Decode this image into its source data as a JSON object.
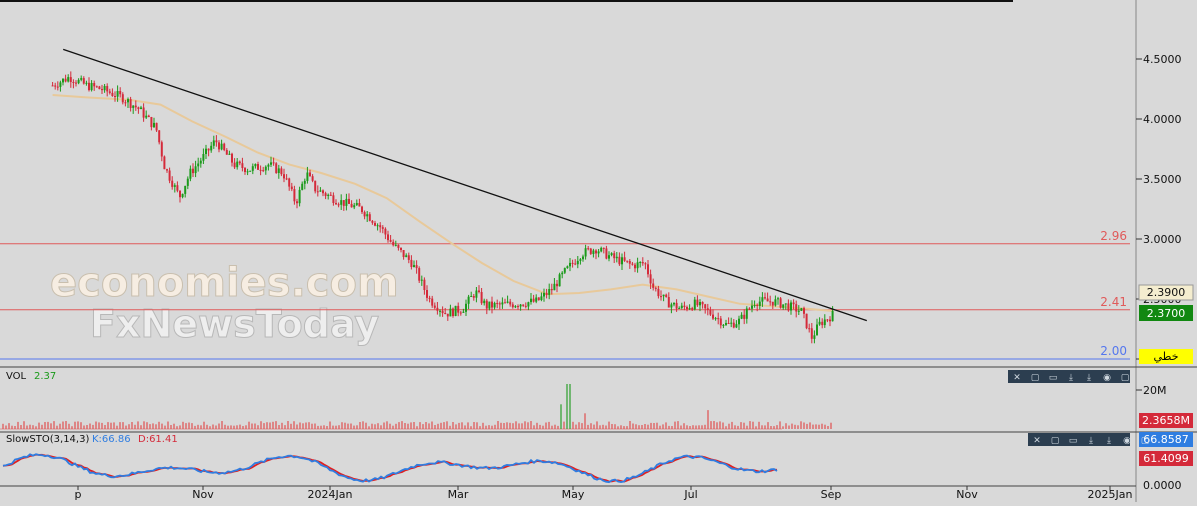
{
  "colors": {
    "background": "#d9d9d9",
    "bull": "#1a9a1a",
    "bear": "#d42a3a",
    "ma": "#e8c99a",
    "trendline": "#111111",
    "level_red": "#e05a5a",
    "level_blue": "#5577ee",
    "stoch_k": "#2f7de1",
    "stoch_d": "#e02020",
    "volume": "#e05050"
  },
  "watermark": {
    "line1": "economies.com",
    "line2": "FxNewsToday"
  },
  "price_panel": {
    "y_ticks": [
      "4.5000",
      "4.0000",
      "3.5000",
      "3.0000",
      "2.5000",
      "2.0000"
    ],
    "levels": [
      {
        "label": "2.96",
        "value": 2.96,
        "color": "#e05a5a"
      },
      {
        "label": "2.41",
        "value": 2.41,
        "color": "#e05a5a"
      },
      {
        "label": "2.00",
        "value": 2.0,
        "color": "#5577ee"
      }
    ],
    "tag_prev": "2.3900",
    "tag_last": "2.3700",
    "tag_arabic": "خطي"
  },
  "volume_panel": {
    "name": "VOL",
    "value": "2.37",
    "y_tick": "20M",
    "tag": "2.3658M"
  },
  "stoch_panel": {
    "name": "SlowSTO(3,14,3)",
    "k_text": "K:66.86",
    "d_text": "D:61.41",
    "y_tick": "0.0000",
    "tag_k": "66.8587",
    "tag_d": "61.4099"
  },
  "panel_buttons": [
    "✕",
    "▢",
    "▭",
    "⤓",
    "⤓",
    "◉",
    "▢"
  ],
  "x_ticks": [
    "Sep",
    "Nov",
    "2024Jan",
    "Mar",
    "May",
    "Jul",
    "Sep",
    "Nov",
    "2025Jan"
  ],
  "chart_data": {
    "type": "candlestick",
    "x_range": [
      "2023-09-01",
      "2025-01-01"
    ],
    "ylim": [
      1.95,
      4.7
    ],
    "grid": false,
    "price_path": [
      [
        "2023-08-20",
        4.28
      ],
      [
        "2023-08-28",
        4.35
      ],
      [
        "2023-09-05",
        4.28
      ],
      [
        "2023-09-12",
        4.25
      ],
      [
        "2023-09-22",
        4.18
      ],
      [
        "2023-09-30",
        4.08
      ],
      [
        "2023-10-08",
        3.92
      ],
      [
        "2023-10-12",
        3.6
      ],
      [
        "2023-10-19",
        3.35
      ],
      [
        "2023-10-24",
        3.55
      ],
      [
        "2023-10-31",
        3.7
      ],
      [
        "2023-11-05",
        3.82
      ],
      [
        "2023-11-14",
        3.62
      ],
      [
        "2023-11-21",
        3.58
      ],
      [
        "2023-11-30",
        3.62
      ],
      [
        "2023-12-07",
        3.55
      ],
      [
        "2023-12-13",
        3.3
      ],
      [
        "2023-12-18",
        3.55
      ],
      [
        "2023-12-22",
        3.42
      ],
      [
        "2024-01-02",
        3.32
      ],
      [
        "2024-01-13",
        3.25
      ],
      [
        "2024-01-22",
        3.1
      ],
      [
        "2024-01-28",
        2.95
      ],
      [
        "2024-02-06",
        2.8
      ],
      [
        "2024-02-14",
        2.5
      ],
      [
        "2024-02-22",
        2.38
      ],
      [
        "2024-03-01",
        2.42
      ],
      [
        "2024-03-07",
        2.56
      ],
      [
        "2024-03-12",
        2.44
      ],
      [
        "2024-03-25",
        2.46
      ],
      [
        "2024-04-05",
        2.48
      ],
      [
        "2024-04-12",
        2.58
      ],
      [
        "2024-04-18",
        2.72
      ],
      [
        "2024-04-26",
        2.88
      ],
      [
        "2024-05-03",
        2.92
      ],
      [
        "2024-05-10",
        2.85
      ],
      [
        "2024-05-20",
        2.78
      ],
      [
        "2024-05-26",
        2.8
      ],
      [
        "2024-05-30",
        2.6
      ],
      [
        "2024-06-05",
        2.48
      ],
      [
        "2024-06-12",
        2.42
      ],
      [
        "2024-06-19",
        2.46
      ],
      [
        "2024-06-28",
        2.36
      ],
      [
        "2024-07-04",
        2.28
      ],
      [
        "2024-07-10",
        2.32
      ],
      [
        "2024-07-17",
        2.48
      ],
      [
        "2024-07-26",
        2.48
      ],
      [
        "2024-08-02",
        2.44
      ],
      [
        "2024-08-08",
        2.4
      ],
      [
        "2024-08-13",
        2.18
      ],
      [
        "2024-08-17",
        2.3
      ],
      [
        "2024-08-23",
        2.37
      ]
    ],
    "ma_path": [
      [
        "2023-08-20",
        4.2
      ],
      [
        "2023-09-05",
        4.18
      ],
      [
        "2023-09-25",
        4.16
      ],
      [
        "2023-10-10",
        4.12
      ],
      [
        "2023-10-25",
        3.98
      ],
      [
        "2023-11-10",
        3.85
      ],
      [
        "2023-11-25",
        3.72
      ],
      [
        "2023-12-10",
        3.62
      ],
      [
        "2023-12-25",
        3.55
      ],
      [
        "2024-01-10",
        3.46
      ],
      [
        "2024-01-25",
        3.34
      ],
      [
        "2024-02-10",
        3.14
      ],
      [
        "2024-02-25",
        2.96
      ],
      [
        "2024-03-10",
        2.8
      ],
      [
        "2024-03-25",
        2.65
      ],
      [
        "2024-04-10",
        2.54
      ],
      [
        "2024-04-25",
        2.55
      ],
      [
        "2024-05-10",
        2.58
      ],
      [
        "2024-05-25",
        2.62
      ],
      [
        "2024-06-10",
        2.58
      ],
      [
        "2024-06-25",
        2.52
      ],
      [
        "2024-07-10",
        2.46
      ],
      [
        "2024-07-25",
        2.44
      ],
      [
        "2024-08-10",
        2.42
      ],
      [
        "2024-08-23",
        2.4
      ]
    ],
    "trendline": [
      [
        "2023-08-25",
        4.58
      ],
      [
        "2024-09-08",
        2.32
      ]
    ],
    "volume_spikes": [
      [
        "2024-04-20",
        1.0
      ],
      [
        "2024-04-16",
        0.55
      ],
      [
        "2024-06-25",
        0.42
      ],
      [
        "2024-04-28",
        0.35
      ]
    ]
  }
}
